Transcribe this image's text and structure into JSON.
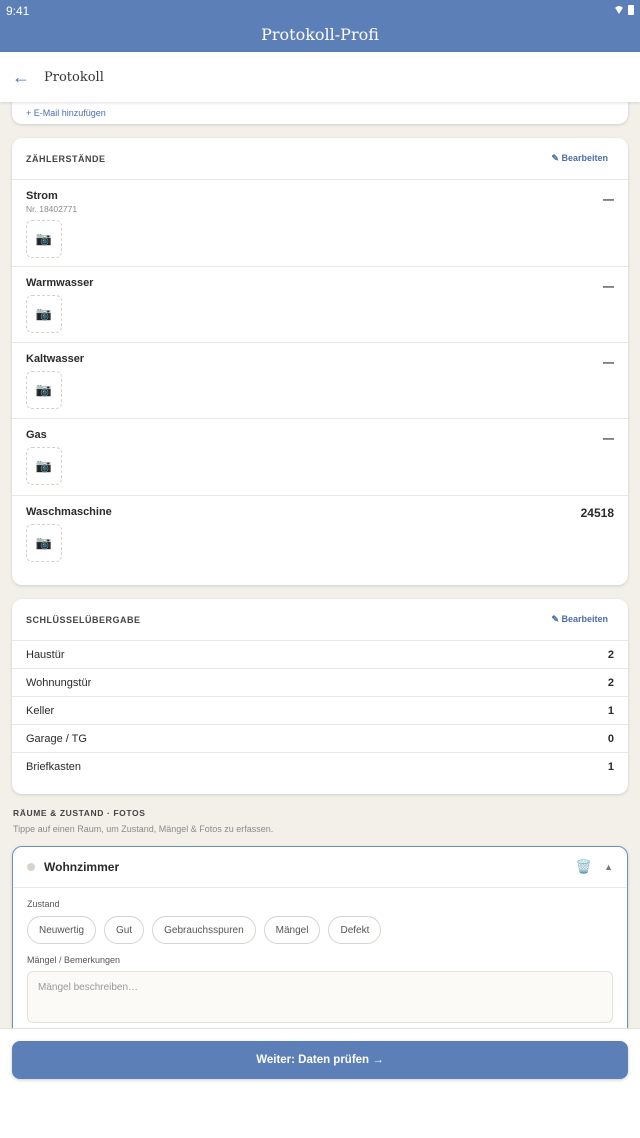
{
  "status": {
    "time": "9:41"
  },
  "app": {
    "title": "Protokoll-Profi"
  },
  "toolbar": {
    "back_icon": "←",
    "title": "Protokoll"
  },
  "prev_card": {
    "link": "+ E-Mail hinzufügen"
  },
  "meters": {
    "heading": "ZÄHLERSTÄNDE",
    "edit": "✎ Bearbeiten",
    "camera_icon": "📷",
    "items": [
      {
        "name": "Strom",
        "nr": "Nr. 18402771",
        "value": "—"
      },
      {
        "name": "Warmwasser",
        "nr": "",
        "value": "—"
      },
      {
        "name": "Kaltwasser",
        "nr": "",
        "value": "—"
      },
      {
        "name": "Gas",
        "nr": "",
        "value": "—"
      },
      {
        "name": "Waschmaschine",
        "nr": "",
        "value": "24518"
      }
    ]
  },
  "keys": {
    "heading": "SCHLÜSSELÜBERGABE",
    "edit": "✎ Bearbeiten",
    "items": [
      {
        "name": "Haustür",
        "count": "2"
      },
      {
        "name": "Wohnungstür",
        "count": "2"
      },
      {
        "name": "Keller",
        "count": "1"
      },
      {
        "name": "Garage / TG",
        "count": "0"
      },
      {
        "name": "Briefkasten",
        "count": "1"
      }
    ]
  },
  "rooms": {
    "heading": "RÄUME & ZUSTAND · FOTOS",
    "subtitle": "Tippe auf einen Raum, um Zustand, Mängel & Fotos zu erfassen.",
    "room": {
      "name": "Wohnzimmer",
      "trash_icon": "🗑️",
      "caret_icon": "▲",
      "condition_label": "Zustand",
      "conditions": [
        "Neuwertig",
        "Gut",
        "Gebrauchsspuren",
        "Mängel",
        "Defekt"
      ],
      "remarks_label": "Mängel / Bemerkungen",
      "remarks_placeholder": "Mängel beschreiben…"
    }
  },
  "cta": {
    "label": "Weiter: Daten prüfen →"
  }
}
